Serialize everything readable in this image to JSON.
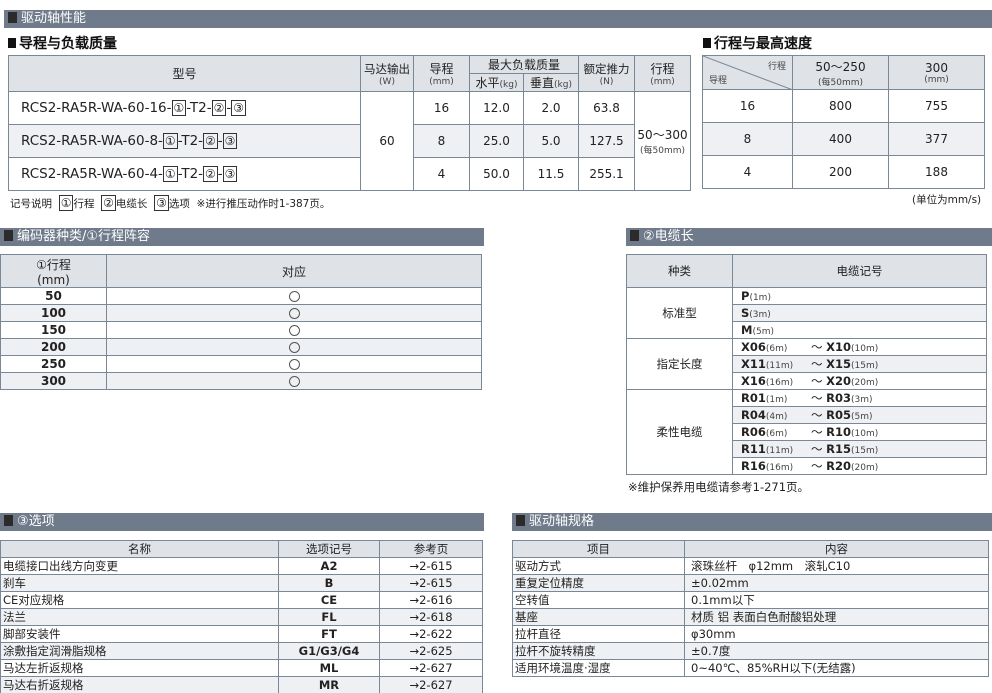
{
  "sec1": {
    "title": "驱动轴性能"
  },
  "perf": {
    "subtitle": "导程与负载质量",
    "h_model": "型号",
    "h_motor": "马达输出",
    "h_motor_u": "(W)",
    "h_lead": "导程",
    "h_lead_u": "(mm)",
    "h_load": "最大负载质量",
    "h_horiz": "水平",
    "h_vert": "垂直",
    "h_kg": "(kg)",
    "h_thrust": "额定推力",
    "h_thrust_u": "(N)",
    "h_stroke": "行程",
    "h_stroke_u": "(mm)",
    "motor": "60",
    "stroke": "50～300",
    "stroke_note": "(每50mm)",
    "rows": [
      {
        "prefix": "RCS2-RA5R-WA-60-16-",
        "lead": "16",
        "horiz": "12.0",
        "vert": "2.0",
        "thrust": "63.8"
      },
      {
        "prefix": "RCS2-RA5R-WA-60-8-",
        "lead": "8",
        "horiz": "25.0",
        "vert": "5.0",
        "thrust": "127.5"
      },
      {
        "prefix": "RCS2-RA5R-WA-60-4-",
        "lead": "4",
        "horiz": "50.0",
        "vert": "11.5",
        "thrust": "255.1"
      }
    ],
    "c1": "①",
    "c2": "②",
    "c3": "③",
    "t2": "-T2-",
    "dash": "-"
  },
  "legend": {
    "label": "记号说明",
    "k1": "①",
    "v1": "行程",
    "k2": "②",
    "v2": "电缆长",
    "k3": "③",
    "v3": "选项",
    "note": "※进行推压动作时1-387页。"
  },
  "speed": {
    "subtitle": "行程与最高速度",
    "diag_top": "行程",
    "diag_bottom": "导程",
    "col1": "50～250",
    "col1_note": "(每50mm)",
    "col2": "300",
    "col2_u": "(mm)",
    "rows": [
      {
        "lead": "16",
        "a": "800",
        "b": "755"
      },
      {
        "lead": "8",
        "a": "400",
        "b": "377"
      },
      {
        "lead": "4",
        "a": "200",
        "b": "188"
      }
    ],
    "unit": "(单位为mm/s)"
  },
  "sec2": {
    "title": "编码器种类/①行程阵容"
  },
  "strokes": {
    "h1": "①行程",
    "h1_u": "(mm)",
    "h2": "对应",
    "rows": [
      "50",
      "100",
      "150",
      "200",
      "250",
      "300"
    ]
  },
  "sec3": {
    "title": "②电缆长"
  },
  "cable": {
    "h1": "种类",
    "h2": "电缆记号",
    "standard": "标准型",
    "specified": "指定长度",
    "flex": "柔性电缆",
    "std_rows": [
      {
        "c": "P",
        "l": "(1m)"
      },
      {
        "c": "S",
        "l": "(3m)"
      },
      {
        "c": "M",
        "l": "(5m)"
      }
    ],
    "spec_rows": [
      {
        "c1": "X06",
        "l1": "(6m)",
        "c2": "X10",
        "l2": "(10m)"
      },
      {
        "c1": "X11",
        "l1": "(11m)",
        "c2": "X15",
        "l2": "(15m)"
      },
      {
        "c1": "X16",
        "l1": "(16m)",
        "c2": "X20",
        "l2": "(20m)"
      }
    ],
    "flex_rows": [
      {
        "c1": "R01",
        "l1": "(1m)",
        "c2": "R03",
        "l2": "(3m)"
      },
      {
        "c1": "R04",
        "l1": "(4m)",
        "c2": "R05",
        "l2": "(5m)"
      },
      {
        "c1": "R06",
        "l1": "(6m)",
        "c2": "R10",
        "l2": "(10m)"
      },
      {
        "c1": "R11",
        "l1": "(11m)",
        "c2": "R15",
        "l2": "(15m)"
      },
      {
        "c1": "R16",
        "l1": "(16m)",
        "c2": "R20",
        "l2": "(20m)"
      }
    ],
    "tilde": "～",
    "note": "※维护保养用电缆请参考1-271页。"
  },
  "sec4": {
    "title": "③选项"
  },
  "options": {
    "h1": "名称",
    "h2": "选项记号",
    "h3": "参考页",
    "rows": [
      {
        "name": "电缆接口出线方向变更",
        "code": "A2",
        "page": "→2-615"
      },
      {
        "name": "刹车",
        "code": "B",
        "page": "→2-615"
      },
      {
        "name": "CE对应规格",
        "code": "CE",
        "page": "→2-616"
      },
      {
        "name": "法兰",
        "code": "FL",
        "page": "→2-618"
      },
      {
        "name": "脚部安装件",
        "code": "FT",
        "page": "→2-622"
      },
      {
        "name": "涂敷指定润滑脂规格",
        "code": "G1/G3/G4",
        "page": "→2-625"
      },
      {
        "name": "马达左折返规格",
        "code": "ML",
        "page": "→2-627"
      },
      {
        "name": "马达右折返规格",
        "code": "MR",
        "page": "→2-627"
      }
    ]
  },
  "sec5": {
    "title": "驱动轴规格"
  },
  "specs": {
    "h1": "项目",
    "h2": "内容",
    "rows": [
      {
        "item": "驱动方式",
        "val": "滚珠丝杆　φ12mm　滚轧C10"
      },
      {
        "item": "重复定位精度",
        "val": "±0.02mm"
      },
      {
        "item": "空转值",
        "val": "0.1mm以下"
      },
      {
        "item": "基座",
        "val": "材质 铝 表面白色耐酸铝处理"
      },
      {
        "item": "拉杆直径",
        "val": "φ30mm"
      },
      {
        "item": "拉杆不旋转精度",
        "val": "±0.7度"
      },
      {
        "item": "适用环境温度·湿度",
        "val": "0~40℃、85%RH以下(无结露)"
      }
    ]
  }
}
